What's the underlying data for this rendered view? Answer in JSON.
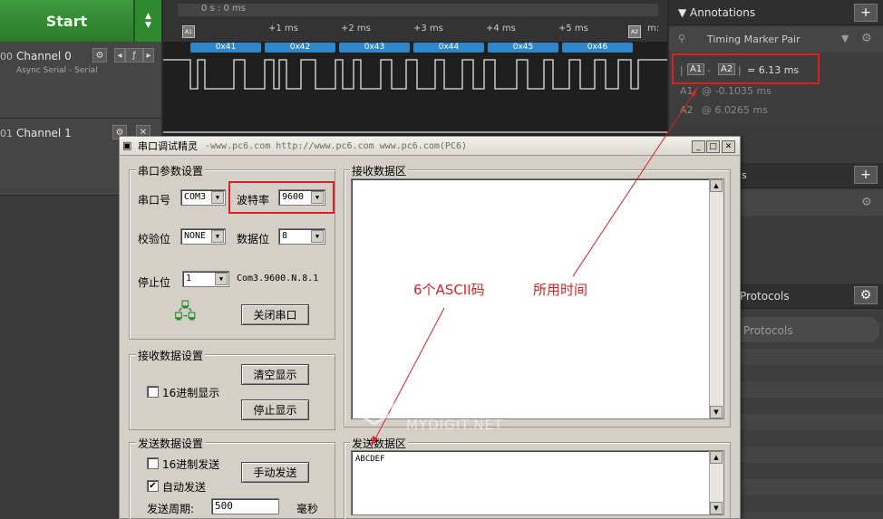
{
  "analyzer": {
    "start_label": "Start",
    "time_header": "0 s : 0 ms",
    "ticks": [
      "+1 ms",
      "+2 ms",
      "+3 ms",
      "+4 ms",
      "+5 ms",
      "m:"
    ],
    "decoded": [
      "0x41",
      "0x42",
      "0x43",
      "0x44",
      "0x45",
      "0x46"
    ],
    "marker1": "A1",
    "marker2": "A2",
    "channels": [
      {
        "num": "00",
        "name": "Channel 0",
        "sub": "Async Serial - Serial"
      },
      {
        "num": "01",
        "name": "Channel 1",
        "sub": ""
      }
    ]
  },
  "annotations_panel": {
    "header": "Annotations",
    "timing_pair": "Timing Marker Pair",
    "m1": "A1",
    "m2": "A2",
    "delta": "= 6.13 ms",
    "a1_label": "A1",
    "a1_value": "@  -0.1035 ms",
    "a2_label": "A2",
    "a2_value": "@  6.0265 ms",
    "protocols_header": "Protocols",
    "protocols_search": "Protocols"
  },
  "dialog": {
    "title": "串口调试精灵",
    "title_url": "-www.pc6.com  http://www.pc6.com     www.pc6.com(PC6)",
    "serial_group": "串口参数设置",
    "port_label": "串口号",
    "port_value": "COM3",
    "baud_label": "波特率",
    "baud_value": "9600",
    "parity_label": "校验位",
    "parity_value": "NONE",
    "databits_label": "数据位",
    "databits_value": "8",
    "stopbits_label": "停止位",
    "stopbits_value": "1",
    "status": "Com3.9600.N.8.1",
    "close_port": "关闭串口",
    "recv_settings_group": "接收数据设置",
    "hex_display": "16进制显示",
    "clear_display": "清空显示",
    "stop_display": "停止显示",
    "send_settings_group": "发送数据设置",
    "hex_send": "16进制发送",
    "manual_send": "手动发送",
    "auto_send": "自动发送",
    "period_label": "发送周期:",
    "period_value": "500",
    "period_unit": "毫秒",
    "recv_area_group": "接收数据区",
    "send_area_group": "发送数据区",
    "send_text": "ABCDEF"
  },
  "overlay": {
    "label_ascii": "6个ASCII码",
    "label_time": "所用时间",
    "watermark_cn": "数码之家",
    "watermark_en": "MYDIGIT.NET"
  }
}
